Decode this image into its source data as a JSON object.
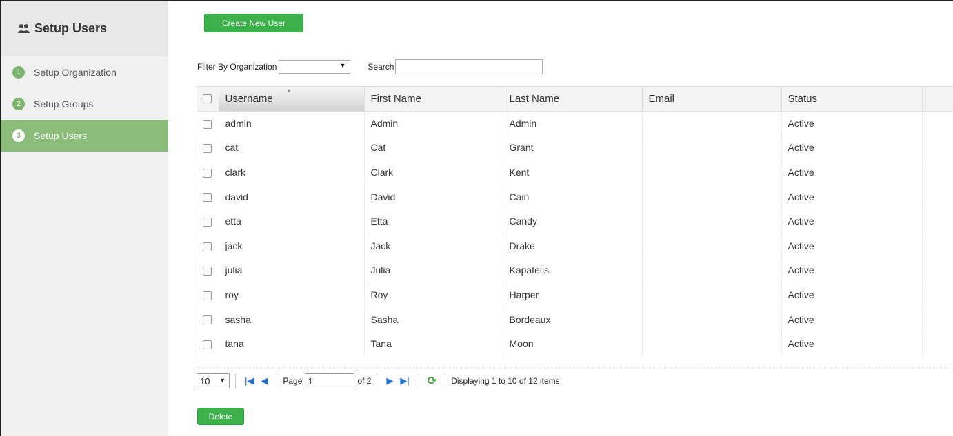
{
  "sidebar": {
    "title": "Setup Users",
    "title_icon": "users-icon",
    "items": [
      {
        "num": "1",
        "label": "Setup Organization",
        "active": false
      },
      {
        "num": "2",
        "label": "Setup Groups",
        "active": false
      },
      {
        "num": "3",
        "label": "Setup Users",
        "active": true
      }
    ]
  },
  "toolbar": {
    "create_label": "Create New User"
  },
  "filter": {
    "label": "Filter By Organization",
    "selected": "",
    "search_label": "Search",
    "search_value": ""
  },
  "table": {
    "columns": [
      "Username",
      "First Name",
      "Last Name",
      "Email",
      "Status"
    ],
    "rows": [
      {
        "username": "admin",
        "first": "Admin",
        "last": "Admin",
        "email": "",
        "status": "Active"
      },
      {
        "username": "cat",
        "first": "Cat",
        "last": "Grant",
        "email": "",
        "status": "Active"
      },
      {
        "username": "clark",
        "first": "Clark",
        "last": "Kent",
        "email": "",
        "status": "Active"
      },
      {
        "username": "david",
        "first": "David",
        "last": "Cain",
        "email": "",
        "status": "Active"
      },
      {
        "username": "etta",
        "first": "Etta",
        "last": "Candy",
        "email": "",
        "status": "Active"
      },
      {
        "username": "jack",
        "first": "Jack",
        "last": "Drake",
        "email": "",
        "status": "Active"
      },
      {
        "username": "julia",
        "first": "Julia",
        "last": "Kapatelis",
        "email": "",
        "status": "Active"
      },
      {
        "username": "roy",
        "first": "Roy",
        "last": "Harper",
        "email": "",
        "status": "Active"
      },
      {
        "username": "sasha",
        "first": "Sasha",
        "last": "Bordeaux",
        "email": "",
        "status": "Active"
      },
      {
        "username": "tana",
        "first": "Tana",
        "last": "Moon",
        "email": "",
        "status": "Active"
      }
    ]
  },
  "pager": {
    "page_size": "10",
    "page_label": "Page",
    "page_value": "1",
    "of_label": "of 2",
    "display_text": "Displaying 1 to 10 of 12 items"
  },
  "footer": {
    "delete_label": "Delete"
  },
  "colors": {
    "accent": "#3db24b",
    "sidebar_active": "#8bbd7a"
  }
}
